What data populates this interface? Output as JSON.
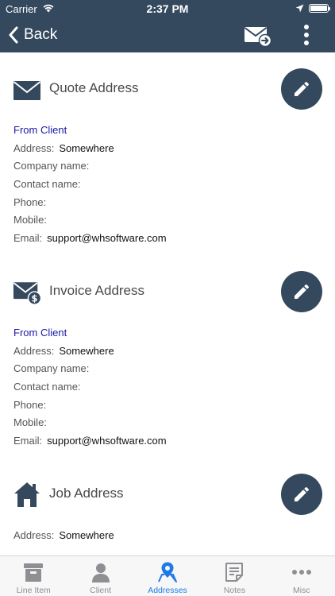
{
  "status_bar": {
    "carrier": "Carrier",
    "time": "2:37 PM",
    "battery_level": 1.0
  },
  "nav": {
    "back_label": "Back",
    "send_icon": "mail-send-icon",
    "more_icon": "more-vertical-icon"
  },
  "sections": [
    {
      "title": "Quote Address",
      "icon": "envelope-icon",
      "source": "From Client",
      "fields": [
        {
          "label": "Address:",
          "value": "Somewhere"
        },
        {
          "label": "Company name:",
          "value": ""
        },
        {
          "label": "Contact name:",
          "value": ""
        },
        {
          "label": "Phone:",
          "value": ""
        },
        {
          "label": "Mobile:",
          "value": ""
        },
        {
          "label": "Email:",
          "value": "support@whsoftware.com"
        }
      ]
    },
    {
      "title": "Invoice Address",
      "icon": "envelope-dollar-icon",
      "source": "From Client",
      "fields": [
        {
          "label": "Address:",
          "value": "Somewhere"
        },
        {
          "label": "Company name:",
          "value": ""
        },
        {
          "label": "Contact name:",
          "value": ""
        },
        {
          "label": "Phone:",
          "value": ""
        },
        {
          "label": "Mobile:",
          "value": ""
        },
        {
          "label": "Email:",
          "value": "support@whsoftware.com"
        }
      ]
    },
    {
      "title": "Job Address",
      "icon": "house-icon",
      "fields": [
        {
          "label": "Address:",
          "value": "Somewhere"
        }
      ]
    }
  ],
  "tabs": [
    {
      "label": "Line Item",
      "icon": "archive-box-icon",
      "active": false
    },
    {
      "label": "Client",
      "icon": "person-icon",
      "active": false
    },
    {
      "label": "Addresses",
      "icon": "map-pin-icon",
      "active": true
    },
    {
      "label": "Notes",
      "icon": "notes-icon",
      "active": false
    },
    {
      "label": "Misc",
      "icon": "more-horizontal-icon",
      "active": false
    }
  ],
  "colors": {
    "header": "#34495e",
    "accent": "#1e7be6",
    "source_link": "#1a1aa6",
    "tab_inactive": "#8e8e93"
  }
}
